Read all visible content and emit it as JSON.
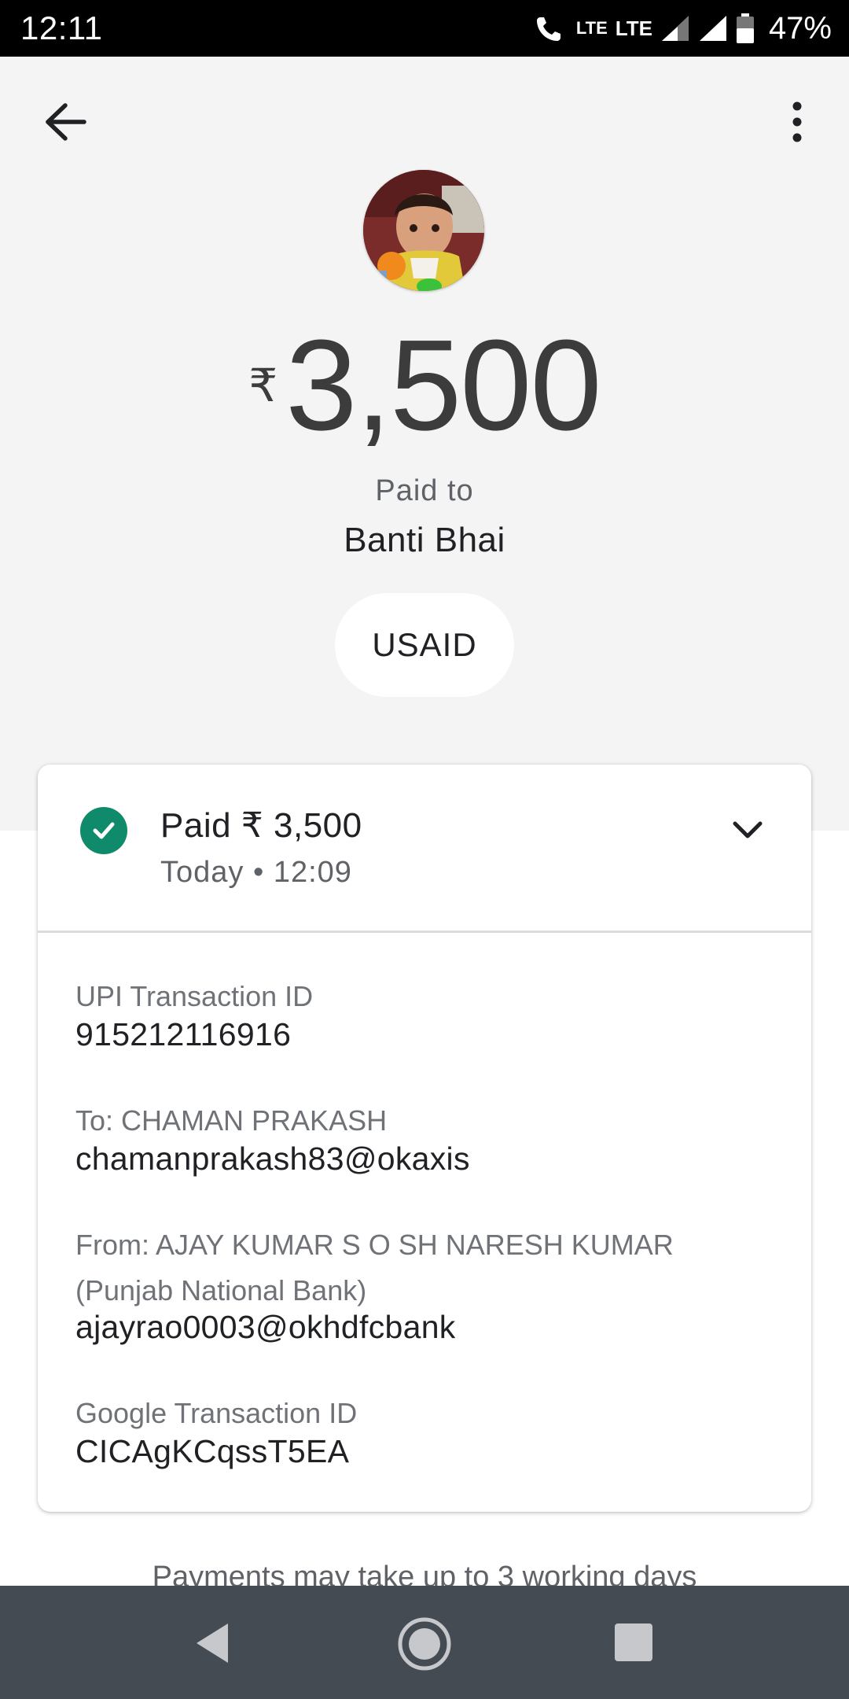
{
  "status_bar": {
    "time": "12:11",
    "network_label_1": "LTE",
    "network_label_2": "LTE",
    "battery_percent": "47%"
  },
  "header": {
    "back_icon": "arrow-left-icon",
    "more_icon": "more-vertical-icon"
  },
  "payment": {
    "currency_symbol": "₹",
    "amount": "3,500",
    "paid_to_label": "Paid to",
    "payee_name": "Banti Bhai",
    "note": "USAID"
  },
  "card": {
    "status_icon": "check-circle-icon",
    "summary": "Paid ₹ 3,500",
    "time": "Today • 12:09",
    "expand_icon": "chevron-down-icon",
    "details": {
      "upi_label": "UPI Transaction ID",
      "upi_value": "915212116916",
      "to_label": "To: CHAMAN PRAKASH",
      "to_value": "chamanprakash83@okaxis",
      "from_label_line1": "From: AJAY KUMAR S O SH NARESH KUMAR",
      "from_label_line2": "(Punjab National Bank)",
      "from_value": "ajayrao0003@okhdfcbank",
      "google_label": "Google Transaction ID",
      "google_value": "CICAgKCqssT5EA"
    }
  },
  "footer_note": "Payments may take up to 3 working days",
  "colors": {
    "success_green": "#0f8a6a",
    "header_bg": "#f4f4f4",
    "nav_bar_bg": "#454b52"
  }
}
